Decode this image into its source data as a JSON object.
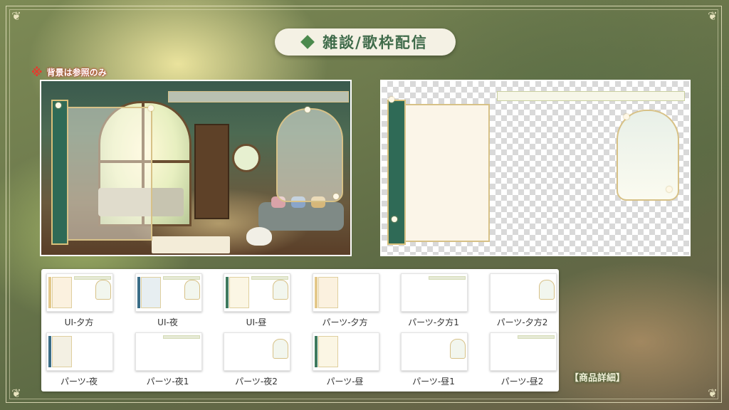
{
  "header": {
    "title": "雑談/歌枠配信"
  },
  "note": {
    "mark": "※",
    "text": "背景は参照のみ"
  },
  "previews": {
    "scene": {
      "name": "scene-preview"
    },
    "transparent": {
      "name": "transparent-preview"
    }
  },
  "thumbnails": [
    {
      "label": "UI-夕方",
      "side": "#e3c88a",
      "panel": "#fbf1df",
      "bar": true,
      "arch": true
    },
    {
      "label": "UI-夜",
      "side": "#3a6d87",
      "panel": "#e7eef1",
      "bar": true,
      "arch": true
    },
    {
      "label": "UI-昼",
      "side": "#3f7a5e",
      "panel": "#fbf6e4",
      "bar": true,
      "arch": true
    },
    {
      "label": "パーツ-夕方",
      "side": "#e3c88a",
      "panel": "#fbf1df",
      "bar": false,
      "arch": false
    },
    {
      "label": "パーツ-夕方1",
      "side": "",
      "panel": "",
      "bar": true,
      "arch": false
    },
    {
      "label": "パーツ-夕方2",
      "side": "",
      "panel": "",
      "bar": false,
      "arch": true
    },
    {
      "label": "パーツ-夜",
      "side": "#3a6d87",
      "panel": "#f3f0e3",
      "bar": false,
      "arch": false
    },
    {
      "label": "パーツ-夜1",
      "side": "",
      "panel": "",
      "bar": true,
      "arch": false
    },
    {
      "label": "パーツ-夜2",
      "side": "",
      "panel": "",
      "bar": false,
      "arch": true
    },
    {
      "label": "パーツ-昼",
      "side": "#3f7a5e",
      "panel": "#fbf6e4",
      "bar": false,
      "arch": false
    },
    {
      "label": "パーツ-昼1",
      "side": "",
      "panel": "",
      "bar": false,
      "arch": true
    },
    {
      "label": "パーツ-昼2",
      "side": "",
      "panel": "",
      "bar": true,
      "arch": false
    }
  ],
  "footer": {
    "detail_link": "【商品詳細】"
  },
  "colors": {
    "accent": "#3f6b4a",
    "note_mark": "#e53a2e"
  }
}
